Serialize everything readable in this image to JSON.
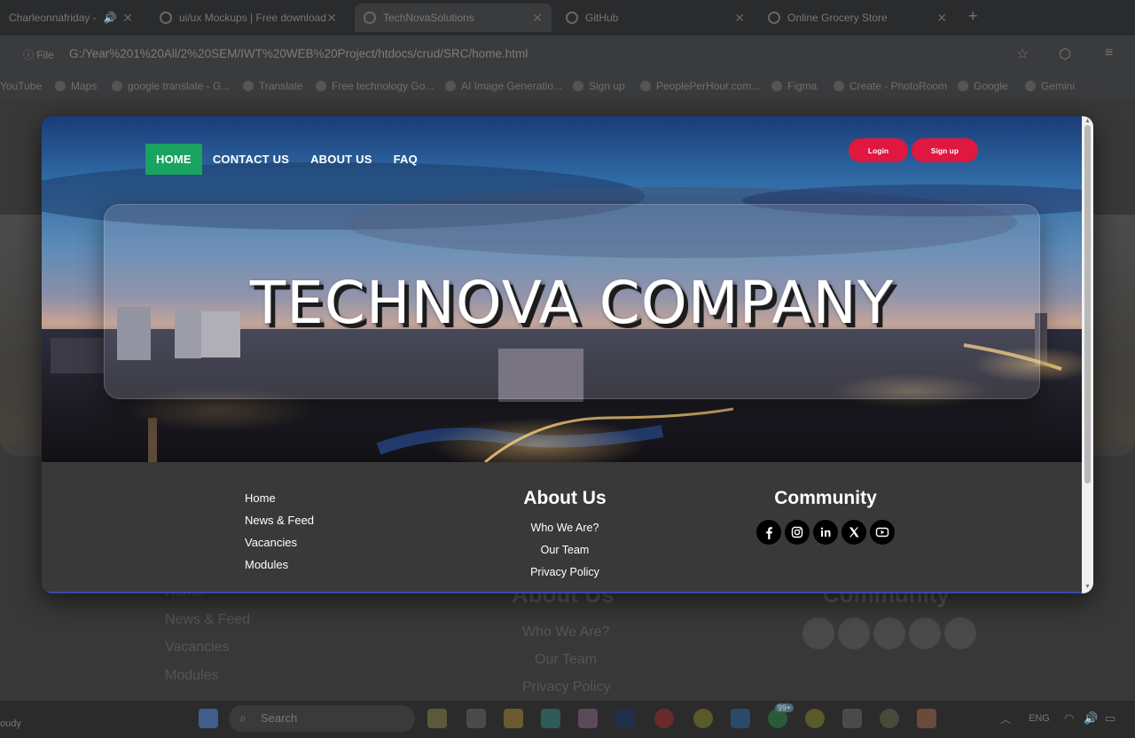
{
  "browser": {
    "tabs": [
      {
        "label": "Charleonnafriday - ",
        "audio": true
      },
      {
        "label": "ui/ux Mockups | Free download"
      },
      {
        "label": "TechNovaSolutions",
        "active": true
      },
      {
        "label": "GitHub"
      },
      {
        "label": "Online Grocery Store"
      }
    ],
    "address": {
      "file_label": "File",
      "url": "G:/Year%201%20All/2%20SEM/IWT%20WEB%20Project/htdocs/crud/SRC/home.html"
    },
    "bookmarks": [
      "YouTube",
      "Maps",
      "google translate - G...",
      "Translate",
      "Free technology Go...",
      "AI Image Generatio...",
      "Sign up",
      "PeoplePerHour.com...",
      "Figma",
      "Create - PhotoRoom",
      "Google",
      "Gemini"
    ]
  },
  "nav": {
    "items": [
      "HOME",
      "CONTACT US",
      "ABOUT US",
      "FAQ"
    ],
    "active": "HOME"
  },
  "auth": {
    "login": "Login",
    "signup": "Sign up"
  },
  "hero": {
    "title": "TECHNOVA COMPANY"
  },
  "footer": {
    "links": [
      "Home",
      "News & Feed",
      "Vacancies",
      "Modules"
    ],
    "about": {
      "heading": "About Us",
      "items": [
        "Who We Are?",
        "Our Team",
        "Privacy Policy"
      ]
    },
    "community": {
      "heading": "Community",
      "icons": [
        "facebook-icon",
        "instagram-icon",
        "linkedin-icon",
        "x-icon",
        "youtube-icon"
      ]
    }
  },
  "background_page": {
    "links": [
      "Home",
      "News & Feed",
      "Vacancies",
      "Modules"
    ],
    "about": {
      "heading": "About Us",
      "items": [
        "Who We Are?",
        "Our Team",
        "Privacy Policy"
      ]
    },
    "community": {
      "heading": "Community"
    }
  },
  "taskbar": {
    "search_placeholder": "Search",
    "weather": "oudy",
    "language": "ENG",
    "badge": "99+"
  },
  "colors": {
    "nav_active": "#1aa260",
    "auth_button": "#e0173e",
    "footer_bg": "#393939"
  }
}
